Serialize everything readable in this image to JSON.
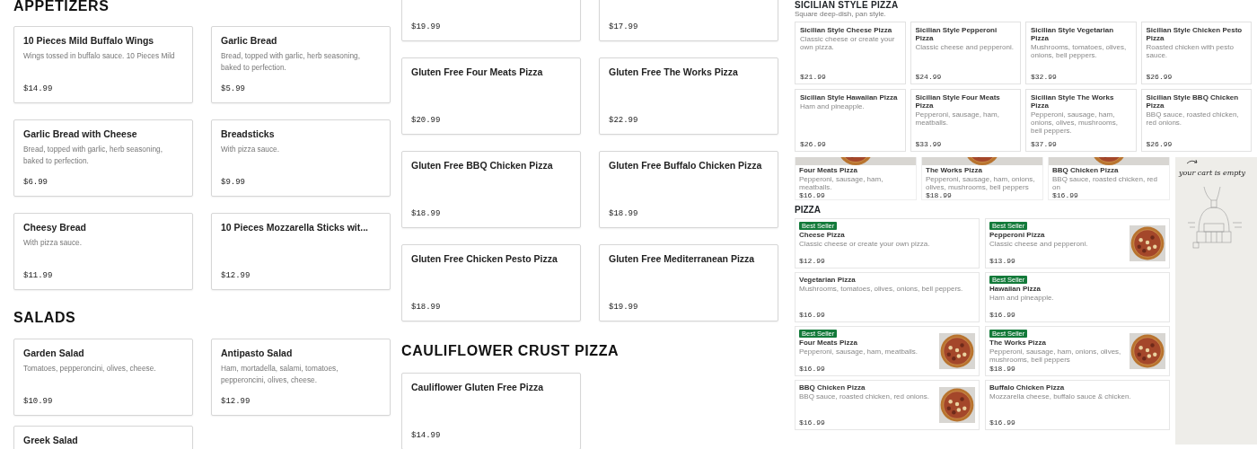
{
  "left": {
    "sections": [
      {
        "title": "APPETIZERS",
        "items": [
          {
            "name": "10 Pieces Mild Buffalo Wings",
            "description": "Wings tossed in buffalo sauce. 10 Pieces Mild",
            "price": "$14.99"
          },
          {
            "name": "Garlic Bread",
            "description": "Bread, topped with garlic, herb seasoning, baked to perfection.",
            "price": "$5.99"
          },
          {
            "name": "Garlic Bread with Cheese",
            "description": "Bread, topped with garlic, herb seasoning, baked to perfection.",
            "price": "$6.99"
          },
          {
            "name": "Breadsticks",
            "description": "With pizza sauce.",
            "price": "$9.99"
          },
          {
            "name": "Cheesy Bread",
            "description": "With pizza sauce.",
            "price": "$11.99"
          },
          {
            "name": "10 Pieces Mozzarella Sticks wit...",
            "price": "$12.99"
          }
        ]
      },
      {
        "title": "SALADS",
        "items": [
          {
            "name": "Garden Salad",
            "description": "Tomatoes, pepperoncini, olives, cheese.",
            "price": "$10.99"
          },
          {
            "name": "Antipasto Salad",
            "description": "Ham, mortadella, salami, tomatoes, pepperoncini, olives, cheese.",
            "price": "$12.99"
          },
          {
            "name": "Greek Salad"
          }
        ]
      }
    ]
  },
  "middle": {
    "sections": [
      {
        "items": [
          {
            "price": "$19.99"
          },
          {
            "price": "$17.99"
          },
          {
            "name": "Gluten Free Four Meats Pizza",
            "price": "$20.99"
          },
          {
            "name": "Gluten Free The Works Pizza",
            "price": "$22.99"
          },
          {
            "name": "Gluten Free BBQ Chicken Pizza",
            "price": "$18.99"
          },
          {
            "name": "Gluten Free Buffalo Chicken Pizza",
            "price": "$18.99"
          },
          {
            "name": "Gluten Free Chicken Pesto Pizza",
            "price": "$18.99"
          },
          {
            "name": "Gluten Free Mediterranean Pizza",
            "price": "$19.99"
          }
        ]
      },
      {
        "title": "CAULIFLOWER CRUST PIZZA",
        "items": [
          {
            "name": "Cauliflower Gluten Free Pizza",
            "price": "$14.99"
          }
        ]
      }
    ]
  },
  "preview_top": {
    "title": "SICILIAN STYLE PIZZA",
    "subtitle": "Square deep-dish, pan style.",
    "items": [
      {
        "name": "Sicilian Style Cheese Pizza",
        "description": "Classic cheese or create your own pizza.",
        "price": "$21.99"
      },
      {
        "name": "Sicilian Style Pepperoni Pizza",
        "description": "Classic cheese and pepperoni.",
        "price": "$24.99"
      },
      {
        "name": "Sicilian Style Vegetarian Pizza",
        "description": "Mushrooms, tomatoes, olives, onions, bell peppers.",
        "price": "$32.99"
      },
      {
        "name": "Sicilian Style Chicken Pesto Pizza",
        "description": "Roasted chicken with pesto sauce.",
        "price": "$26.99"
      },
      {
        "name": "Sicilian Style Hawaiian Pizza",
        "description": "Ham and pineapple.",
        "price": "$26.99"
      },
      {
        "name": "Sicilian Style Four Meats Pizza",
        "description": "Pepperoni, sausage, ham, meatballs.",
        "price": "$33.99"
      },
      {
        "name": "Sicilian Style The Works Pizza",
        "description": "Pepperoni, sausage, ham, onions, olives, mushrooms, bell peppers.",
        "price": "$37.99"
      },
      {
        "name": "Sicilian Style BBQ Chicken Pizza",
        "description": "BBQ sauce, roasted chicken, red onions.",
        "price": "$26.99"
      }
    ]
  },
  "preview_bottom": {
    "featured": [
      {
        "name": "Four Meats Pizza",
        "description": "Pepperoni, sausage, ham, meatballs.",
        "price": "$16.99"
      },
      {
        "name": "The Works Pizza",
        "description": "Pepperoni, sausage, ham, onions, olives, mushrooms, bell peppers",
        "price": "$18.99"
      },
      {
        "name": "BBQ Chicken Pizza",
        "description": "BBQ sauce, roasted chicken, red on",
        "price": "$16.99"
      }
    ],
    "title": "PIZZA",
    "items": [
      {
        "kind": "plain",
        "badge": "Best Seller",
        "name": "Cheese Pizza",
        "description": "Classic cheese or create your own pizza.",
        "price": "$12.99"
      },
      {
        "kind": "with-picture",
        "badge": "Best Seller",
        "name": "Pepperoni Pizza",
        "description": "Classic cheese and pepperoni.",
        "price": "$13.99"
      },
      {
        "kind": "plain",
        "name": "Vegetarian Pizza",
        "description": "Mushrooms, tomatoes, olives, onions, bell peppers.",
        "price": "$16.99"
      },
      {
        "kind": "plain",
        "badge": "Best Seller",
        "name": "Hawaiian Pizza",
        "description": "Ham and pineapple.",
        "price": "$16.99"
      },
      {
        "kind": "with-picture",
        "badge": "Best Seller",
        "name": "Four Meats Pizza",
        "description": "Pepperoni, sausage, ham, meatballs.",
        "price": "$16.99"
      },
      {
        "kind": "with-picture",
        "badge": "Best Seller",
        "name": "The Works Pizza",
        "description": "Pepperoni, sausage, ham, onions, olives, mushrooms, bell peppers",
        "price": "$18.99"
      },
      {
        "kind": "with-picture",
        "name": "BBQ Chicken Pizza",
        "description": "BBQ sauce, roasted chicken, red onions.",
        "price": "$16.99"
      },
      {
        "kind": "plain",
        "name": "Buffalo Chicken Pizza",
        "description": "Mozzarella cheese, buffalo sauce & chicken.",
        "price": "$16.99"
      }
    ]
  },
  "cart": {
    "message": "your cart is empty"
  }
}
